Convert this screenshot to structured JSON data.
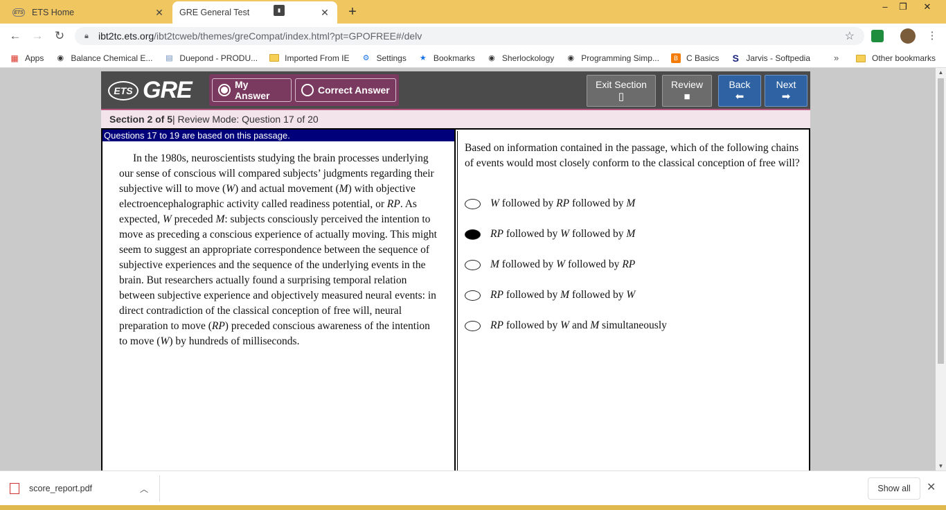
{
  "browser": {
    "tabs": [
      {
        "title": "ETS Home",
        "active": false
      },
      {
        "title": "GRE General Test",
        "active": true
      }
    ],
    "window_controls": {
      "minimize": "–",
      "restore": "❐",
      "close": "✕"
    },
    "url": {
      "host": "ibt2tc.ets.org",
      "path": "/ibt2tcweb/themes/greCompat/index.html?pt=GPOFREE#/delv"
    },
    "bookmarks": [
      {
        "label": "Apps",
        "icon": "apps-grid-icon"
      },
      {
        "label": "Balance Chemical E...",
        "icon": "globe-icon"
      },
      {
        "label": "Duepond - PRODU...",
        "icon": "page-icon"
      },
      {
        "label": "Imported From IE",
        "icon": "folder-icon"
      },
      {
        "label": "Settings",
        "icon": "gear-icon"
      },
      {
        "label": "Bookmarks",
        "icon": "star-icon"
      },
      {
        "label": "Sherlockology",
        "icon": "globe-icon"
      },
      {
        "label": "Programming Simp...",
        "icon": "globe-icon"
      },
      {
        "label": "C Basics",
        "icon": "blogger-icon"
      },
      {
        "label": "Jarvis - Softpedia",
        "icon": "s-logo-icon"
      }
    ],
    "bookmarks_overflow": "»",
    "other_bookmarks": "Other bookmarks"
  },
  "gre": {
    "logo_ets": "ETS",
    "logo_gre": "GRE",
    "toggle_my_answer": "My Answer",
    "toggle_correct_answer": "Correct Answer",
    "buttons": {
      "exit_section": "Exit Section",
      "review": "Review",
      "back": "Back",
      "next": "Next"
    },
    "section_label": "Section 2 of 5",
    "section_rest": " | Review Mode: Question 17 of 20",
    "passage_header": "Questions 17 to 19 are based on this passage.",
    "question": "Based on information contained in the passage, which of the following chains of events would most closely conform to the classical conception of free will?",
    "options": [
      {
        "a": "W",
        "b": "RP",
        "c": "M",
        "j1": " followed by ",
        "j2": " followed by ",
        "selected": false
      },
      {
        "a": "RP",
        "b": "W",
        "c": "M",
        "j1": " followed by ",
        "j2": " followed by ",
        "selected": true
      },
      {
        "a": "M",
        "b": "W",
        "c": "RP",
        "j1": " followed by ",
        "j2": " followed by ",
        "selected": false
      },
      {
        "a": "RP",
        "b": "M",
        "c": "W",
        "j1": " followed by ",
        "j2": " followed by ",
        "selected": false
      },
      {
        "a": "RP",
        "b": "W",
        "c": "M",
        "j1": " followed by ",
        "j2": " and ",
        "tail": " simultaneously",
        "selected": false
      }
    ]
  },
  "passage": {
    "p1": "In the 1980s, neuroscientists studying the brain processes underlying our sense of conscious will compared subjects’ judgments regarding their subjective will to move (",
    "v1": "W",
    "p2": ") and actual movement (",
    "v2": "M",
    "p3": ") with objective electroencephalographic activity called readiness potential, or ",
    "v3": "RP",
    "p4": ". As expected, ",
    "v4": "W",
    "p5": " preceded ",
    "v5": "M",
    "p6": ": subjects consciously perceived the intention to move as preceding a conscious experience of actually moving. This might seem to suggest an appropriate correspondence between the sequence of subjective experiences and the sequence of the underlying events in the brain. But researchers actually found a surprising temporal relation between subjective experience and objectively measured neural events: in direct contradiction of the classical conception of free will, neural preparation to move (",
    "v6": "RP",
    "p7": ") preceded conscious awareness of the intention to move (",
    "v7": "W",
    "p8": ") by hundreds of milliseconds."
  },
  "downloads": {
    "file": "score_report.pdf",
    "show_all": "Show all"
  },
  "colors": {
    "chrome_frame": "#f0c660",
    "gre_header": "#4b4b4b",
    "toggle_group": "#7a3a5f",
    "nav_button": "#2f62a3",
    "passage_header": "#00007a",
    "section_bar": "#f3e3ea"
  }
}
